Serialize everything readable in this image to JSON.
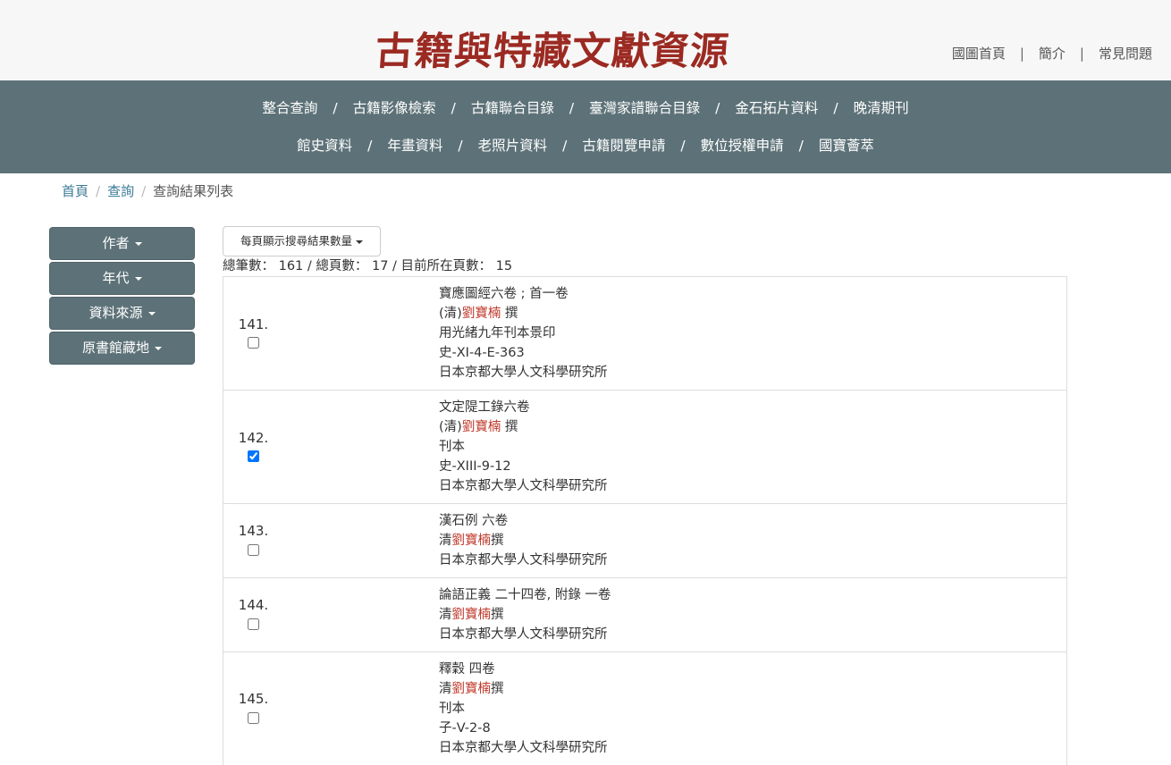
{
  "header": {
    "logo_text": "古籍與特藏文獻資源",
    "links": [
      "國圖首頁",
      "簡介",
      "常見問題"
    ]
  },
  "nav": {
    "row1": [
      "整合查詢",
      "古籍影像檢索",
      "古籍聯合目錄",
      "臺灣家譜聯合目錄",
      "金石拓片資料",
      "晚清期刊"
    ],
    "row2": [
      "館史資料",
      "年畫資料",
      "老照片資料",
      "古籍閱覽申請",
      "數位授權申請",
      "國寶薈萃"
    ],
    "separator": "/"
  },
  "breadcrumb": {
    "items": [
      "首頁",
      "查詢"
    ],
    "current": "查詢結果列表",
    "separator": "/"
  },
  "facets": [
    "作者",
    "年代",
    "資料來源",
    "原書館藏地"
  ],
  "toolbar": {
    "page_size_label": "每頁顯示搜尋結果數量"
  },
  "summary": "總筆數： 161 / 總頁數： 17 / 目前所在頁數： 15",
  "results": [
    {
      "number": "141.",
      "checked": false,
      "title": "寶應圖經六卷 ; 首一卷",
      "author_prefix": "(清)",
      "author_name": "劉寶楠",
      "author_suffix": " 撰",
      "edition": "用光緒九年刊本景印",
      "call_number": "史-XI-4-E-363",
      "holder": "日本京都大學人文科學研究所"
    },
    {
      "number": "142.",
      "checked": true,
      "title": "文定隄工錄六卷",
      "author_prefix": "(清)",
      "author_name": "劉寶楠",
      "author_suffix": " 撰",
      "edition": "刊本",
      "call_number": "史-XIII-9-12",
      "holder": "日本京都大學人文科學研究所"
    },
    {
      "number": "143.",
      "checked": false,
      "title": "漢石例 六卷",
      "author_prefix": "清",
      "author_name": "劉寶楠",
      "author_suffix": "撰",
      "edition": "",
      "call_number": "",
      "holder": "日本京都大學人文科學研究所"
    },
    {
      "number": "144.",
      "checked": false,
      "title": "論語正義 二十四卷, 附錄 一卷",
      "author_prefix": "清",
      "author_name": "劉寶楠",
      "author_suffix": "撰",
      "edition": "",
      "call_number": "",
      "holder": "日本京都大學人文科學研究所"
    },
    {
      "number": "145.",
      "checked": false,
      "title": "釋穀 四卷",
      "author_prefix": "清",
      "author_name": "劉寶楠",
      "author_suffix": "撰",
      "edition": "刊本",
      "call_number": "子-V-2-8",
      "holder": "日本京都大學人文科學研究所"
    }
  ]
}
